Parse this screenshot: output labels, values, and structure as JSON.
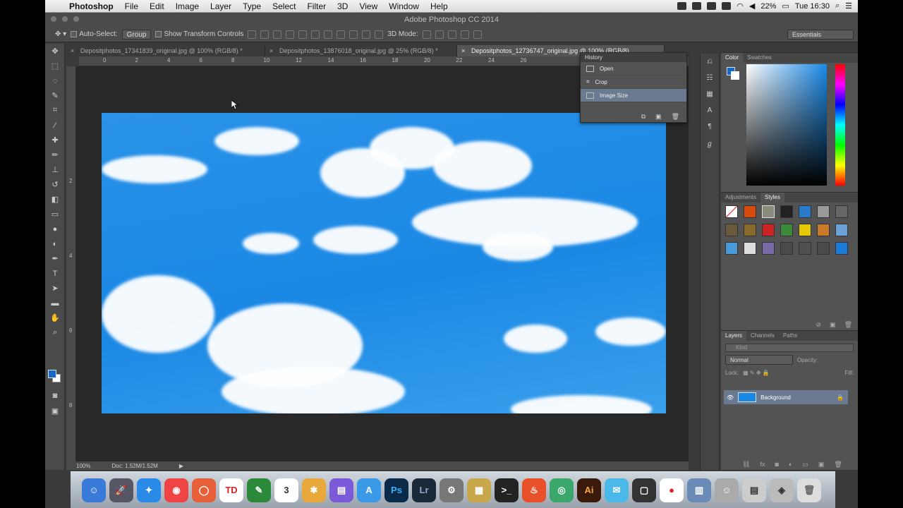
{
  "menubar": {
    "app": "Photoshop",
    "items": [
      "File",
      "Edit",
      "Image",
      "Layer",
      "Type",
      "Select",
      "Filter",
      "3D",
      "View",
      "Window",
      "Help"
    ],
    "battery": "22%",
    "clock": "Tue 16:30"
  },
  "window": {
    "title": "Adobe Photoshop CC 2014"
  },
  "options": {
    "auto_select": "Auto-Select:",
    "group": "Group",
    "transform": "Show Transform Controls",
    "mode3d": "3D Mode:",
    "workspace": "Essentials"
  },
  "tabs": [
    {
      "label": "Depositphotos_17341839_original.jpg @ 100% (RGB/8) *"
    },
    {
      "label": "Depositphotos_13876018_original.jpg @ 25% (RGB/8) *"
    },
    {
      "label": "Depositphotos_12736747_original.jpg @ 100% (RGB/8)"
    }
  ],
  "ruler_top": [
    "0",
    "2",
    "4",
    "6",
    "8",
    "10",
    "12",
    "14",
    "16",
    "18",
    "20",
    "22",
    "24",
    "26"
  ],
  "ruler_left": [
    "2",
    "4",
    "6",
    "8"
  ],
  "history": {
    "title": "History",
    "items": [
      "Open",
      "Crop",
      "Image Size"
    ]
  },
  "status": {
    "zoom": "100%",
    "doc": "Doc: 1.52M/1.52M"
  },
  "color_panel": {
    "tabs": [
      "Color",
      "Swatches"
    ],
    "fg": "#1469c8",
    "bg": "#ffffff"
  },
  "adjust_panel": {
    "tabs": [
      "Adjustments",
      "Styles"
    ]
  },
  "layers_panel": {
    "tabs": [
      "Layers",
      "Channels",
      "Paths"
    ],
    "kind": "Kind",
    "blend": "Normal",
    "opacity_label": "Opacity:",
    "lock_label": "Lock:",
    "fill_label": "Fill:",
    "layer_name": "Background"
  }
}
